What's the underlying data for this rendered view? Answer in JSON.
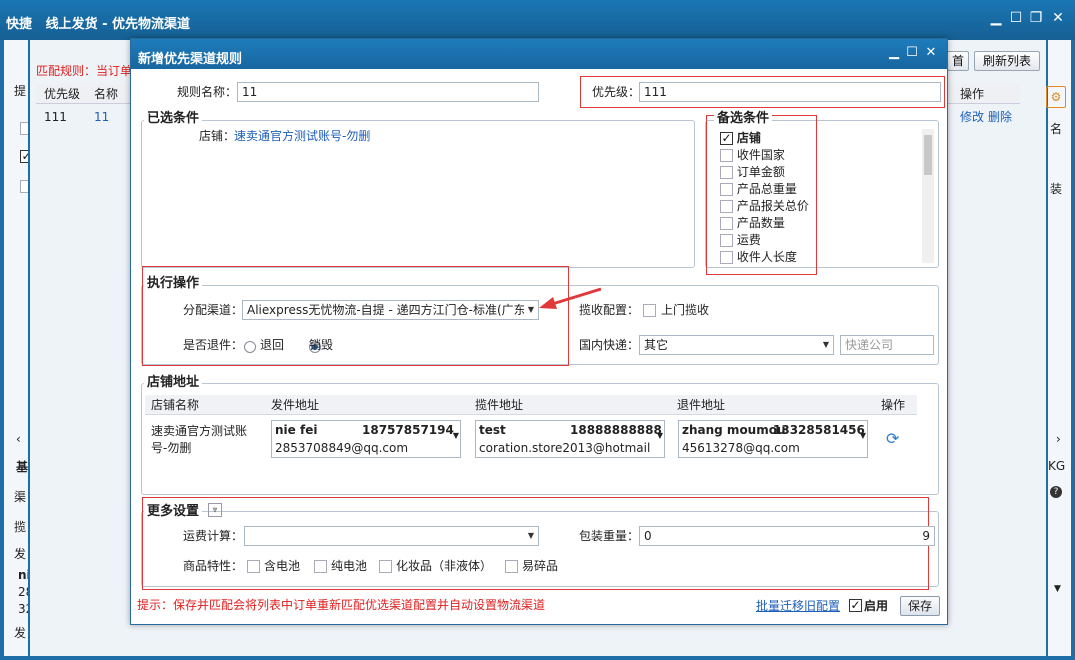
{
  "outer": {
    "title": "线上发货 - 优先物流渠道",
    "app_prefix": "快捷"
  },
  "bg": {
    "match_rule": "匹配规则：当订单",
    "refresh_button": "刷新列表",
    "table_headers": [
      "优先级",
      "名称"
    ],
    "row": {
      "priority": "111",
      "name": "11"
    },
    "ops_header": "操作",
    "op_edit": "修改",
    "op_delete": "删除",
    "frag_ming": "名",
    "frag_zhuang": "装",
    "frag_ti": "提",
    "frag_ji": "基",
    "frag_qu": "渠",
    "frag_lan": "揽",
    "frag_fa": "发",
    "frag_ni": "ni",
    "frag_28": "28",
    "frag_32": "32",
    "frag_fa2": "发",
    "frag_kg": "KG",
    "frag_q": "?"
  },
  "dialog": {
    "title": "新增优先渠道规则",
    "rule_name_label": "规则名称：",
    "rule_name_value": "11",
    "priority_label": "优先级：",
    "priority_value": "111",
    "selected_section": "已选条件",
    "selected_store_label": "店铺：",
    "selected_store_value": "速卖通官方测试账号-勿删",
    "optional_section": "备选条件",
    "conditions": [
      {
        "label": "店铺",
        "checked": true
      },
      {
        "label": "收件国家",
        "checked": false
      },
      {
        "label": "订单金额",
        "checked": false
      },
      {
        "label": "产品总重量",
        "checked": false
      },
      {
        "label": "产品报关总价",
        "checked": false
      },
      {
        "label": "产品数量",
        "checked": false
      },
      {
        "label": "运费",
        "checked": false
      },
      {
        "label": "收件人长度",
        "checked": false
      }
    ],
    "exec_section": "执行操作",
    "channel_label": "分配渠道：",
    "channel_value": "Aliexpress无忧物流-自提 - 递四方江门仓-标准(广东",
    "pickup_label": "揽收配置：",
    "pickup_option": "上门揽收",
    "return_label": "是否退件：",
    "return_options": [
      {
        "label": "退回",
        "selected": false
      },
      {
        "label": "销毁",
        "selected": true
      }
    ],
    "domestic_label": "国内快递：",
    "domestic_value": "其它",
    "express_placeholder": "快递公司",
    "address_section": "店铺地址",
    "addr_headers": [
      "店铺名称",
      "发件地址",
      "揽件地址",
      "退件地址",
      "操作"
    ],
    "addr_row": {
      "store": "速卖通官方测试账号-勿删",
      "send": {
        "name": "nie fei",
        "phone": "18757857194",
        "email": "2853708849@qq.com"
      },
      "pickup": {
        "name": "test",
        "phone": "18888888888",
        "email": "coration.store2013@hotmail."
      },
      "return": {
        "name": "zhang moumou",
        "phone": "13328581456",
        "email": "45613278@qq.com"
      }
    },
    "more_section": "更多设置",
    "freight_label": "运费计算：",
    "weight_label": "包装重量：",
    "weight_value": "0",
    "weight_suffix": "9",
    "product_label": "商品特性：",
    "product_options": [
      "含电池",
      "纯电池",
      "化妆品（非液体）",
      "易碎品"
    ],
    "tip": "提示：保存并匹配会将列表中订单重新匹配优选渠道配置并自动设置物流渠道",
    "migrate_link": "批量迁移旧配置",
    "enable_label": "启用",
    "save_button": "保存"
  },
  "colors": {
    "accent": "#1e6fa8",
    "highlight_red": "#e0393b",
    "tip_red": "#e02020",
    "link": "#1d5fb8"
  }
}
